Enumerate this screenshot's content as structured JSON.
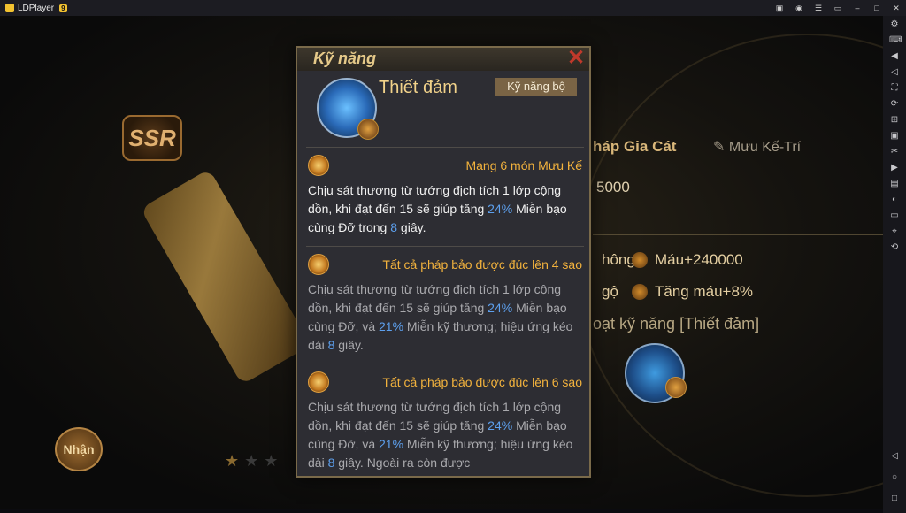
{
  "emulator": {
    "app_name": "LDPlayer",
    "version_badge": "9"
  },
  "background": {
    "rank_badge": "SSR",
    "claim_button": "Nhận",
    "tab_active": "háp Gia Cát",
    "tab_other": "Mưu Kế-Trí",
    "value_1": "5000",
    "stat_1_left": "hông",
    "stat_1_right": "Máu+240000",
    "stat_2_left": "gộ",
    "stat_2_right": "Tăng máu+8%",
    "unlock_text": "oạt kỹ năng [Thiết đảm]",
    "stars_filled": 1,
    "stars_total": 3
  },
  "modal": {
    "title": "Kỹ năng",
    "skill_name": "Thiết đảm",
    "skill_type": "Kỹ năng bộ",
    "sections": [
      {
        "condition": "Mang 6 món Mưu Kế",
        "desc_a": "Chịu sát thương từ tướng địch tích 1 lớp cộng dồn, khi đạt đến 15 sẽ giúp tăng ",
        "v1": "24%",
        "desc_b": " Miễn bạo cùng Đỡ trong ",
        "v2": "8",
        "desc_c": " giây."
      },
      {
        "condition": "Tất cả pháp bảo được đúc lên 4 sao",
        "desc_a": "Chịu sát thương từ tướng địch tích 1 lớp cộng dồn, khi đạt đến 15 sẽ giúp tăng ",
        "v1": "24%",
        "desc_b": " Miễn bạo cùng Đỡ, và ",
        "v2": "21%",
        "desc_c": " Miễn kỹ thương; hiệu ứng kéo dài ",
        "v3": "8",
        "desc_d": " giây."
      },
      {
        "condition": "Tất cả pháp bảo được đúc lên 6 sao",
        "desc_a": "Chịu sát thương từ tướng địch tích 1 lớp cộng dồn, khi đạt đến 15 sẽ giúp tăng ",
        "v1": "24%",
        "desc_b": " Miễn bạo cùng Đỡ, và ",
        "v2": "21%",
        "desc_c": " Miễn kỹ thương; hiệu ứng kéo dài ",
        "v3": "8",
        "desc_d": " giây. Ngoài ra còn được"
      }
    ]
  },
  "colors": {
    "accent_gold": "#f2b23d",
    "highlight_blue": "#5da0ee",
    "close_red": "#c0392b"
  },
  "icons": {
    "close": "close-icon",
    "skill": "skill-icon",
    "condition": "condition-icon"
  }
}
